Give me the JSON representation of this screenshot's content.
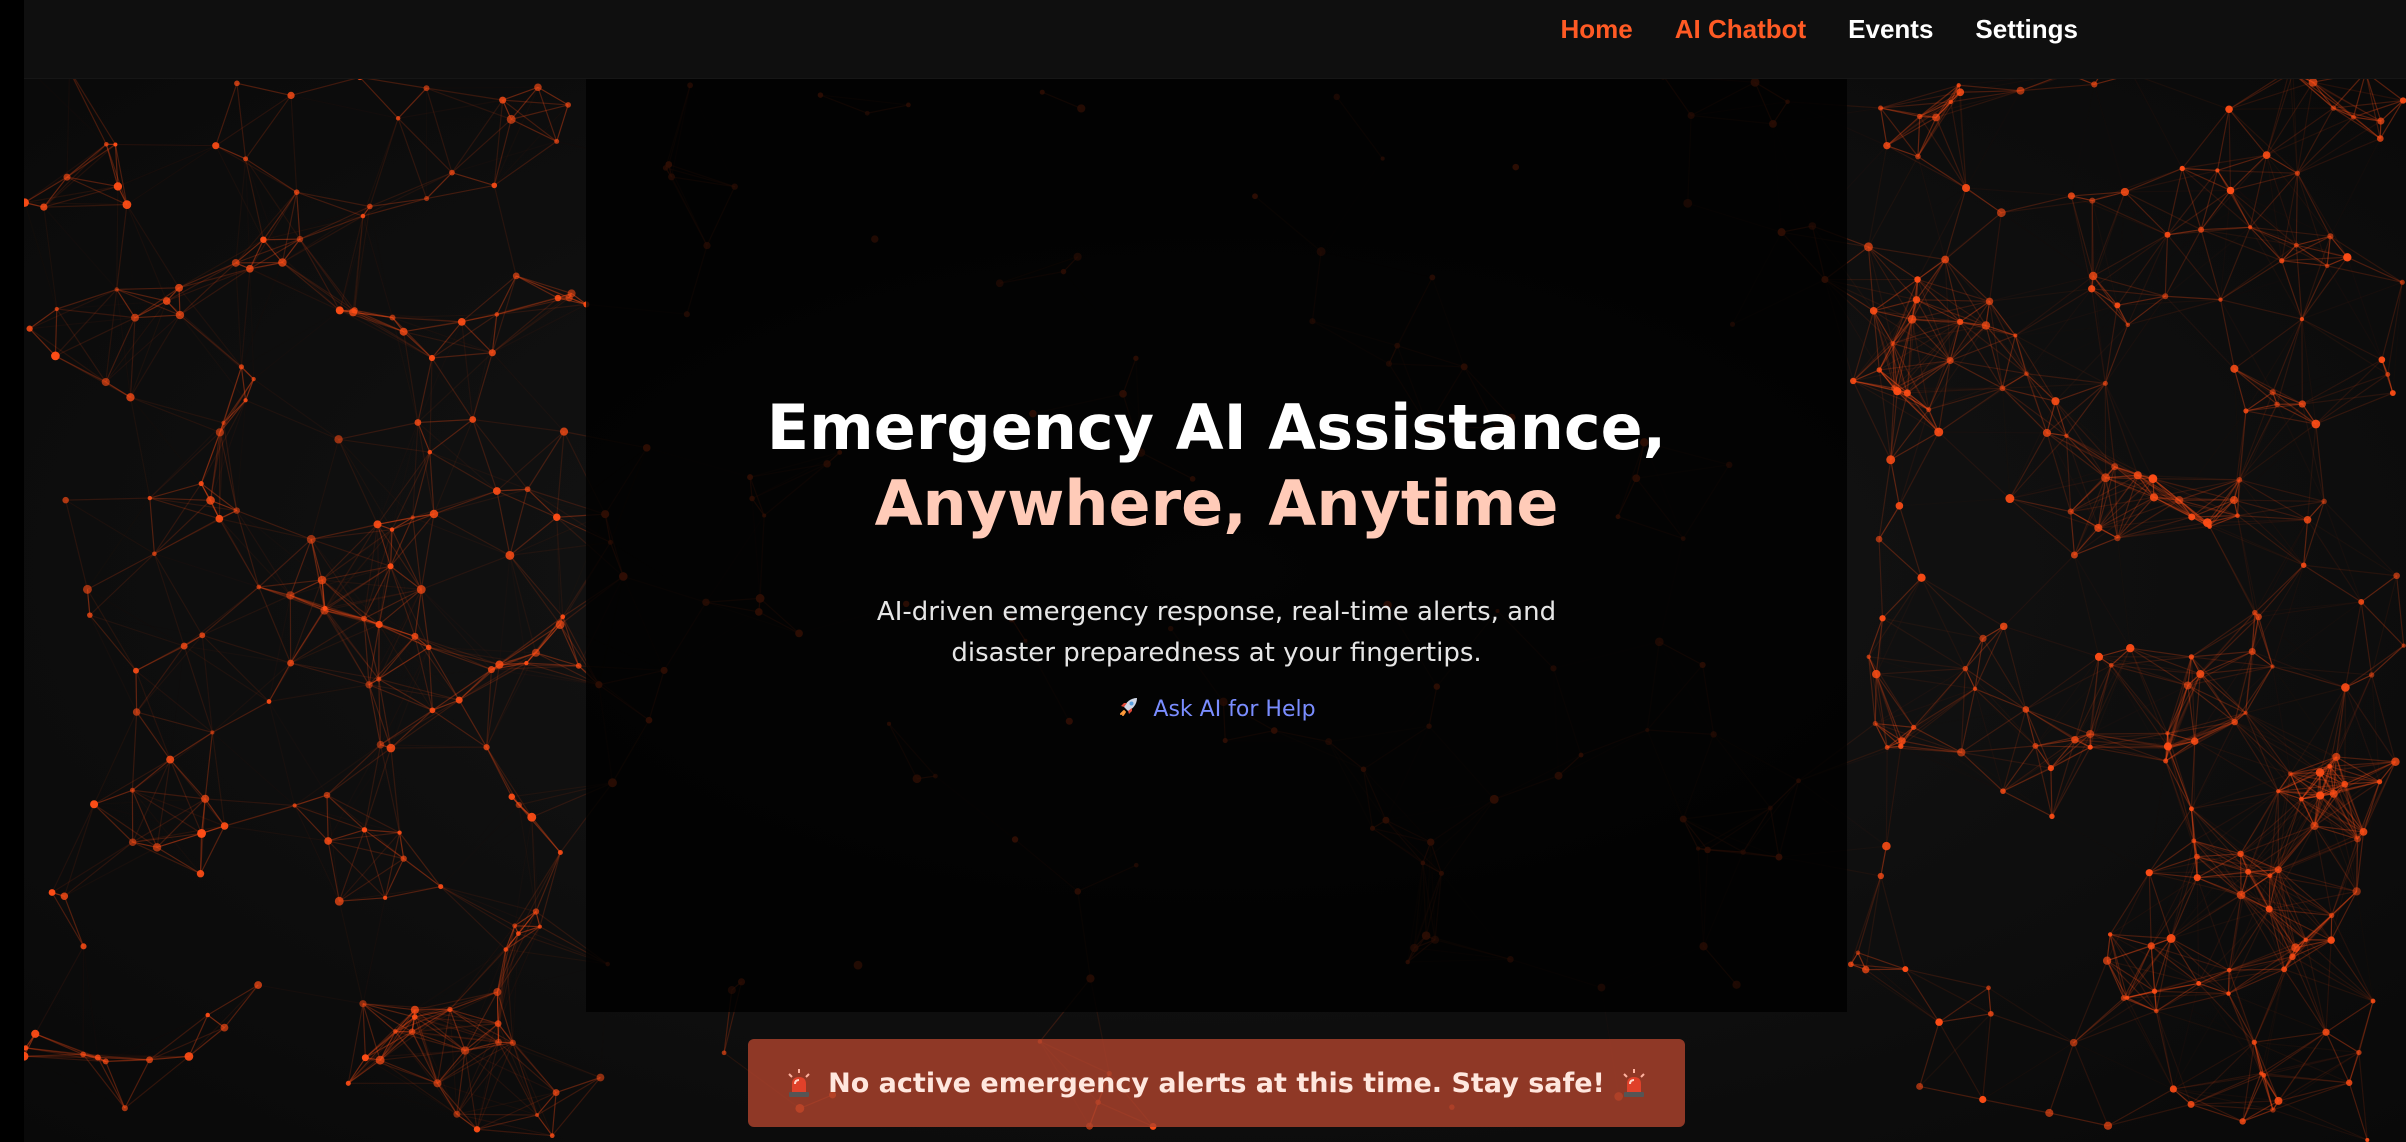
{
  "nav": {
    "items": [
      {
        "label": "Home",
        "active": true
      },
      {
        "label": "AI Chatbot",
        "active": true
      },
      {
        "label": "Events",
        "active": false
      },
      {
        "label": "Settings",
        "active": false
      }
    ]
  },
  "hero": {
    "title_line1": "Emergency AI Assistance,",
    "title_line2": "Anywhere, Anytime",
    "subtitle": "AI-driven emergency response, real-time alerts, and disaster preparedness at your fingertips.",
    "cta_icon": "rocket-icon",
    "cta_label": "Ask AI for Help"
  },
  "alert": {
    "icon": "siren-icon",
    "text": "No active emergency alerts at this time. Stay safe!"
  },
  "colors": {
    "accent": "#ff5a24",
    "title_highlight": "#ffcbb8",
    "cta": "#7a8dff",
    "alert_bg": "#ac422c",
    "network": "#ff4d16"
  }
}
